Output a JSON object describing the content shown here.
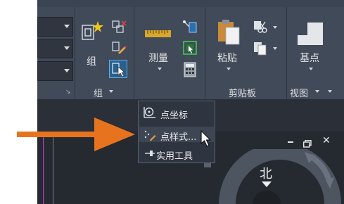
{
  "ribbon": {
    "group_panel": {
      "button_label": "组",
      "panel_label": "组"
    },
    "measure": {
      "label": "测量"
    },
    "clipboard": {
      "paste_label": "粘贴",
      "panel_label": "剪贴板"
    },
    "base": {
      "label": "基点"
    },
    "view_panel_label": "视图"
  },
  "dropdown": {
    "items": [
      {
        "label": "点坐标"
      },
      {
        "label": "点样式..."
      },
      {
        "label": "实用工具"
      }
    ]
  },
  "viewcube": {
    "north_label": "北"
  },
  "window_controls": {
    "close": "✕"
  },
  "colors": {
    "annotation_arrow": "#e8731e",
    "ribbon_bg": "#404a59",
    "accent_blue": "#3aa0e8"
  }
}
